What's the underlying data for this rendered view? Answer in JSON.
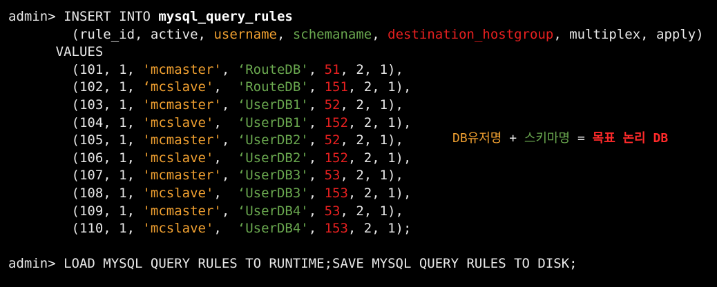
{
  "terminal": {
    "insert_line": {
      "prompt": "admin> ",
      "command": "INSERT INTO ",
      "table": "mysql_query_rules"
    },
    "columns_line": {
      "indent": "        ",
      "open": "(",
      "c1": "rule_id, active, ",
      "c_username": "username",
      "sep1": ", ",
      "c_schemaname": "schemaname",
      "sep2": ", ",
      "c_hostgroup": "destination_hostgroup",
      "rest": ", multiplex, apply)"
    },
    "values_keyword": "      VALUES",
    "rows": [
      {
        "prefix": "        (101, 1, ",
        "user": "'mcmaster'",
        "mid": ", ",
        "schema": "‘RouteDB'",
        "sep": ", ",
        "hostgroup": "51",
        "suffix": ", 2, 1),"
      },
      {
        "prefix": "        (102, 1, ",
        "user": "‘mcslave'",
        "mid": ",  ",
        "schema": "'RouteDB'",
        "sep": ", ",
        "hostgroup": "151",
        "suffix": ", 2, 1),"
      },
      {
        "prefix": "        (103, 1, ",
        "user": "'mcmaster'",
        "mid": ", ",
        "schema": "‘UserDB1'",
        "sep": ", ",
        "hostgroup": "52",
        "suffix": ", 2, 1),"
      },
      {
        "prefix": "        (104, 1, ",
        "user": "'mcslave'",
        "mid": ",  ",
        "schema": "‘UserDB1'",
        "sep": ", ",
        "hostgroup": "152",
        "suffix": ", 2, 1),"
      },
      {
        "prefix": "        (105, 1, ",
        "user": "'mcmaster'",
        "mid": ", ",
        "schema": "‘UserDB2'",
        "sep": ", ",
        "hostgroup": "52",
        "suffix": ", 2, 1),"
      },
      {
        "prefix": "        (106, 1, ",
        "user": "'mcslave'",
        "mid": ",  ",
        "schema": "‘UserDB2'",
        "sep": ", ",
        "hostgroup": "152",
        "suffix": ", 2, 1),"
      },
      {
        "prefix": "        (107, 1, ",
        "user": "'mcmaster'",
        "mid": ", ",
        "schema": "‘UserDB3'",
        "sep": ", ",
        "hostgroup": "53",
        "suffix": ", 2, 1),"
      },
      {
        "prefix": "        (108, 1, ",
        "user": "'mcslave'",
        "mid": ",  ",
        "schema": "‘UserDB3'",
        "sep": ", ",
        "hostgroup": "153",
        "suffix": ", 2, 1),"
      },
      {
        "prefix": "        (109, 1, ",
        "user": "'mcmaster'",
        "mid": ", ",
        "schema": "‘UserDB4'",
        "sep": ", ",
        "hostgroup": "53",
        "suffix": ", 2, 1),"
      },
      {
        "prefix": "        (110, 1, ",
        "user": "'mcslave'",
        "mid": ",  ",
        "schema": "‘UserDB4'",
        "sep": ", ",
        "hostgroup": "153",
        "suffix": ", 2, 1);"
      }
    ],
    "load_line": {
      "prompt": "admin> ",
      "command": "LOAD MYSQL QUERY RULES TO RUNTIME;SAVE MYSQL QUERY RULES TO DISK;"
    }
  },
  "annotation": {
    "db_user": "DB유저명",
    "plus": " + ",
    "schema_name": "스키마명",
    "equals": " = ",
    "target_db": "목표 논리 DB"
  },
  "colors": {
    "background": "#000000",
    "text": "#e8e8e8",
    "username": "#f0a030",
    "schemaname": "#6aa84f",
    "hostgroup": "#e82020"
  }
}
